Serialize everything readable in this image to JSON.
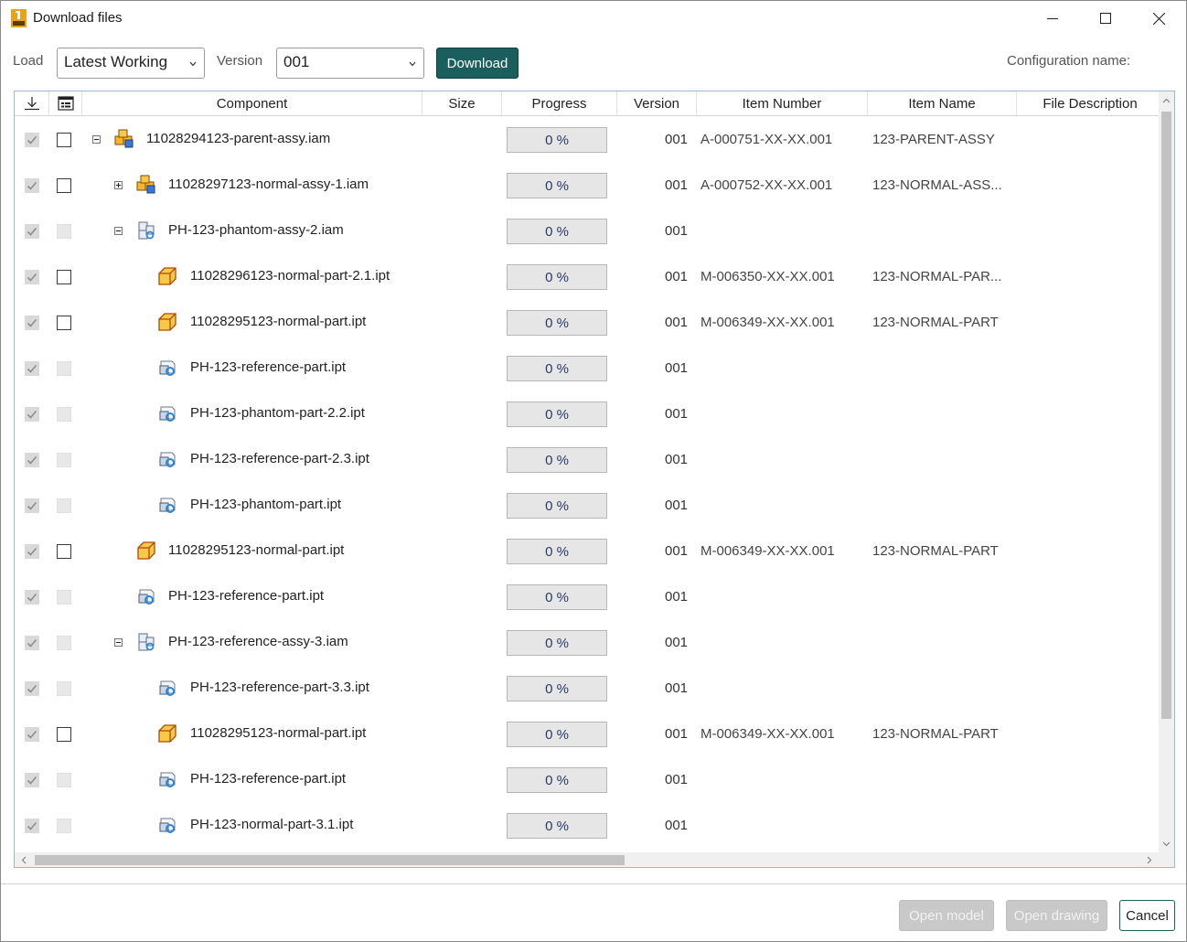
{
  "window": {
    "title": "Download files",
    "minimize_icon": "minimize-icon",
    "maximize_icon": "maximize-icon",
    "close_icon": "close-icon"
  },
  "toolbar": {
    "load_label": "Load",
    "load_value": "Latest Working",
    "version_label": "Version",
    "version_value": "001",
    "download_label": "Download",
    "config_label": "Configuration name:"
  },
  "grid": {
    "columns": {
      "download": "download-icon",
      "select": "select-column-icon",
      "component": "Component",
      "size": "Size",
      "progress": "Progress",
      "version": "Version",
      "item_number": "Item Number",
      "item_name": "Item Name",
      "file_description": "File Description"
    },
    "rows": [
      {
        "name": "11028294123-parent-assy.iam",
        "type": "assy-normal",
        "expander": "minus",
        "selectable": true,
        "progress": "0 %",
        "version": "001",
        "item_number": "A-000751-XX-XX.001",
        "item_name": "123-PARENT-ASSY"
      },
      {
        "name": "11028297123-normal-assy-1.iam",
        "type": "assy-normal",
        "expander": "plus",
        "selectable": true,
        "progress": "0 %",
        "version": "001",
        "item_number": "A-000752-XX-XX.001",
        "item_name": "123-NORMAL-ASS..."
      },
      {
        "name": "PH-123-phantom-assy-2.iam",
        "type": "assy-ref",
        "expander": "minus",
        "selectable": false,
        "progress": "0 %",
        "version": "001",
        "item_number": "",
        "item_name": ""
      },
      {
        "name": "11028296123-normal-part-2.1.ipt",
        "type": "part-normal",
        "expander": "",
        "selectable": true,
        "progress": "0 %",
        "version": "001",
        "item_number": "M-006350-XX-XX.001",
        "item_name": "123-NORMAL-PAR..."
      },
      {
        "name": "11028295123-normal-part.ipt",
        "type": "part-normal",
        "expander": "",
        "selectable": true,
        "progress": "0 %",
        "version": "001",
        "item_number": "M-006349-XX-XX.001",
        "item_name": "123-NORMAL-PART"
      },
      {
        "name": "PH-123-reference-part.ipt",
        "type": "part-ref",
        "expander": "",
        "selectable": false,
        "progress": "0 %",
        "version": "001",
        "item_number": "",
        "item_name": ""
      },
      {
        "name": "PH-123-phantom-part-2.2.ipt",
        "type": "part-ref",
        "expander": "",
        "selectable": false,
        "progress": "0 %",
        "version": "001",
        "item_number": "",
        "item_name": ""
      },
      {
        "name": "PH-123-reference-part-2.3.ipt",
        "type": "part-ref",
        "expander": "",
        "selectable": false,
        "progress": "0 %",
        "version": "001",
        "item_number": "",
        "item_name": ""
      },
      {
        "name": "PH-123-phantom-part.ipt",
        "type": "part-ref",
        "expander": "",
        "selectable": false,
        "progress": "0 %",
        "version": "001",
        "item_number": "",
        "item_name": ""
      },
      {
        "name": "11028295123-normal-part.ipt",
        "type": "part-normal",
        "expander": "",
        "selectable": true,
        "progress": "0 %",
        "version": "001",
        "item_number": "M-006349-XX-XX.001",
        "item_name": "123-NORMAL-PART"
      },
      {
        "name": "PH-123-reference-part.ipt",
        "type": "part-ref",
        "expander": "",
        "selectable": false,
        "progress": "0 %",
        "version": "001",
        "item_number": "",
        "item_name": ""
      },
      {
        "name": "PH-123-reference-assy-3.iam",
        "type": "assy-ref",
        "expander": "minus",
        "selectable": false,
        "progress": "0 %",
        "version": "001",
        "item_number": "",
        "item_name": ""
      },
      {
        "name": "PH-123-reference-part-3.3.ipt",
        "type": "part-ref",
        "expander": "",
        "selectable": false,
        "progress": "0 %",
        "version": "001",
        "item_number": "",
        "item_name": ""
      },
      {
        "name": "11028295123-normal-part.ipt",
        "type": "part-normal",
        "expander": "",
        "selectable": true,
        "progress": "0 %",
        "version": "001",
        "item_number": "M-006349-XX-XX.001",
        "item_name": "123-NORMAL-PART"
      },
      {
        "name": "PH-123-reference-part.ipt",
        "type": "part-ref",
        "expander": "",
        "selectable": false,
        "progress": "0 %",
        "version": "001",
        "item_number": "",
        "item_name": ""
      },
      {
        "name": "PH-123-normal-part-3.1.ipt",
        "type": "part-ref",
        "expander": "",
        "selectable": false,
        "progress": "0 %",
        "version": "001",
        "item_number": "",
        "item_name": ""
      }
    ]
  },
  "footer": {
    "open_model": "Open model",
    "open_drawing": "Open drawing",
    "cancel": "Cancel"
  },
  "colors": {
    "accent": "#1a5e5e",
    "disabled_button": "#c9c9c9",
    "progress_text": "#2b3a67"
  }
}
